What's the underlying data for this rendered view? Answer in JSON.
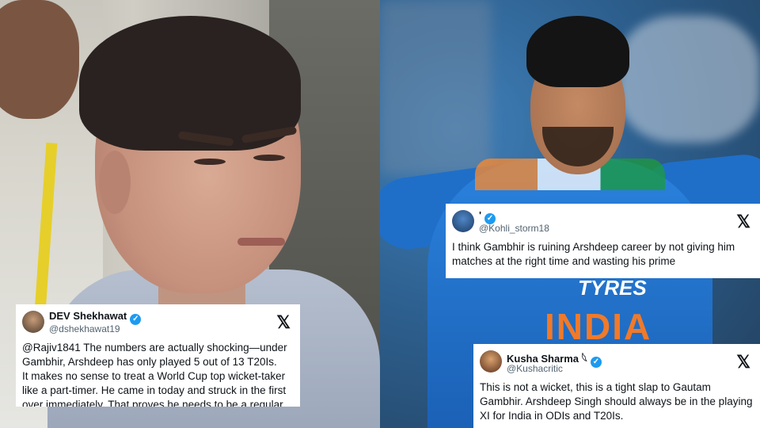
{
  "tweets": {
    "left": {
      "name": "DEV Shekhawat",
      "handle": "@dshekhawat19",
      "lines": [
        "@Rajiv1841 The numbers are actually shocking—under Gambhir, Arshdeep has only played 5 out of 13 T20Is.",
        "It makes no sense to treat a World Cup top wicket-taker like a part-timer. He came in today and struck in the first over immediately. That proves he needs to be a regular starter, not an"
      ]
    },
    "top_right": {
      "name": "'",
      "handle": "@Kohli_storm18",
      "lines": [
        "I think Gambhir is ruining Arshdeep career by not giving him matches at the right time and wasting his prime"
      ]
    },
    "bottom_right": {
      "name": "Kusha Sharma 𓆩",
      "handle": "@Kushacritic",
      "lines": [
        "This is not a wicket, this is a tight slap to Gautam Gambhir. Arshdeep Singh should always be in the playing XI for India in ODIs and T20Is."
      ]
    },
    "verified_icon": "verified-badge-icon",
    "x_logo": "𝕏"
  },
  "photo_text": {
    "sponsor": "TYRES",
    "jersey": "INDIA"
  },
  "colors": {
    "verified": "#1d9bf0",
    "jersey_blue": "#1f6fc9",
    "india_orange": "#f07a2a"
  }
}
